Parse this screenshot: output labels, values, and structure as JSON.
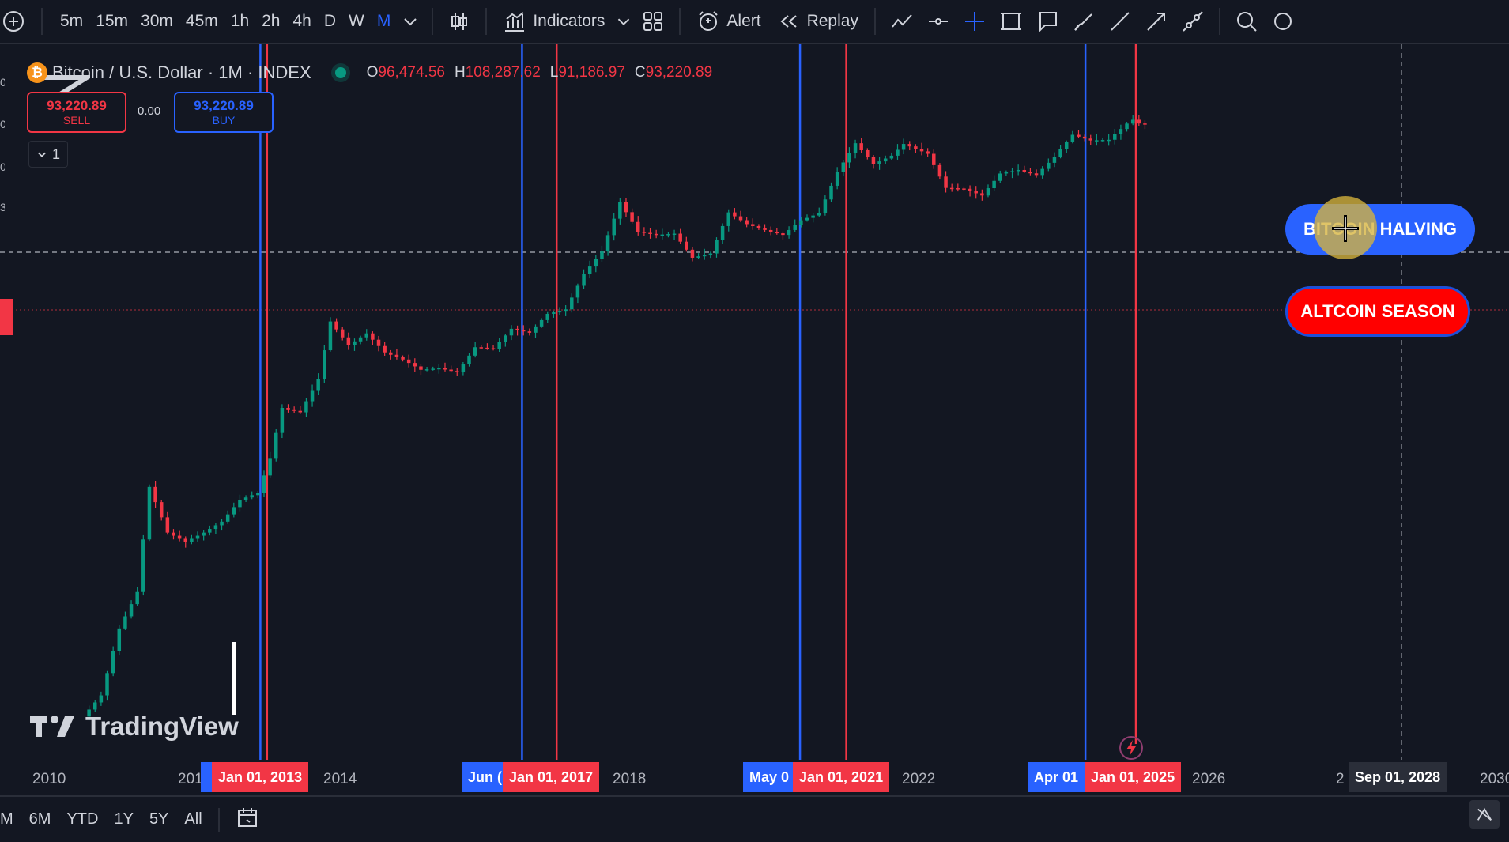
{
  "toolbar": {
    "intervals": [
      "5m",
      "15m",
      "30m",
      "45m",
      "1h",
      "2h",
      "4h",
      "D",
      "W",
      "M"
    ],
    "active_interval": "M",
    "indicators_label": "Indicators",
    "alert_label": "Alert",
    "replay_label": "Replay"
  },
  "legend": {
    "logo_letter": "₿",
    "symbol_title": "Bitcoin / U.S. Dollar · 1M · INDEX",
    "open_key": "O",
    "open_val": "96,474.56",
    "high_key": "H",
    "high_val": "108,287.62",
    "low_key": "L",
    "low_val": "91,186.97",
    "close_key": "C",
    "close_val": "93,220.89"
  },
  "trade": {
    "sell_price": "93,220.89",
    "sell_label": "SELL",
    "spread": "0.00",
    "buy_price": "93,220.89",
    "buy_label": "BUY",
    "collapse_count": "1"
  },
  "annotations": {
    "halving": "BITCOIN HALVING",
    "altcoin": "ALTCOIN SEASON"
  },
  "watermark": "TradingView",
  "time_axis": {
    "years": [
      "2010",
      "201",
      "2014",
      "2018",
      "2022",
      "2026",
      "2",
      "2030"
    ],
    "halving_tags": [
      "",
      "Jun (",
      "May 0",
      "Apr 01"
    ],
    "season_tags": [
      "Jan 01, 2013",
      "Jan 01, 2017",
      "Jan 01, 2021",
      "Jan 01, 2025"
    ],
    "cursor_tag": "Sep 01, 2028"
  },
  "bottom_bar": {
    "ranges": [
      "M",
      "6M",
      "YTD",
      "1Y",
      "5Y",
      "All"
    ]
  },
  "colors": {
    "background": "#131722",
    "up_candle": "#089981",
    "down_candle": "#f23645",
    "halving_line": "#2962ff",
    "season_line": "#f23645"
  },
  "chart_data": {
    "type": "candlestick",
    "symbol": "Bitcoin / U.S. Dollar",
    "interval": "1M",
    "scale": "log",
    "x_range": [
      "2010-01",
      "2030-01"
    ],
    "price_series": [
      [
        "2010-07",
        0.06
      ],
      [
        "2010-10",
        0.1
      ],
      [
        "2011-01",
        0.5
      ],
      [
        "2011-04",
        1.2
      ],
      [
        "2011-06",
        15
      ],
      [
        "2011-09",
        5
      ],
      [
        "2011-12",
        4
      ],
      [
        "2012-03",
        5
      ],
      [
        "2012-06",
        6.5
      ],
      [
        "2012-09",
        11
      ],
      [
        "2012-12",
        13
      ],
      [
        "2013-02",
        30
      ],
      [
        "2013-04",
        100
      ],
      [
        "2013-07",
        90
      ],
      [
        "2013-10",
        200
      ],
      [
        "2013-12",
        800
      ],
      [
        "2014-03",
        450
      ],
      [
        "2014-06",
        600
      ],
      [
        "2014-09",
        380
      ],
      [
        "2014-12",
        320
      ],
      [
        "2015-03",
        250
      ],
      [
        "2015-06",
        260
      ],
      [
        "2015-09",
        235
      ],
      [
        "2015-12",
        430
      ],
      [
        "2016-03",
        415
      ],
      [
        "2016-06",
        670
      ],
      [
        "2016-09",
        610
      ],
      [
        "2016-12",
        960
      ],
      [
        "2017-03",
        1070
      ],
      [
        "2017-06",
        2500
      ],
      [
        "2017-09",
        4300
      ],
      [
        "2017-12",
        14000
      ],
      [
        "2018-03",
        6900
      ],
      [
        "2018-06",
        6400
      ],
      [
        "2018-09",
        6600
      ],
      [
        "2018-12",
        3700
      ],
      [
        "2019-03",
        4100
      ],
      [
        "2019-06",
        11000
      ],
      [
        "2019-09",
        8300
      ],
      [
        "2019-12",
        7200
      ],
      [
        "2020-03",
        6400
      ],
      [
        "2020-06",
        9100
      ],
      [
        "2020-09",
        10800
      ],
      [
        "2020-12",
        29000
      ],
      [
        "2021-03",
        58000
      ],
      [
        "2021-06",
        35000
      ],
      [
        "2021-09",
        43000
      ],
      [
        "2021-11",
        57000
      ],
      [
        "2022-03",
        45000
      ],
      [
        "2022-06",
        19800
      ],
      [
        "2022-09",
        19400
      ],
      [
        "2022-12",
        16500
      ],
      [
        "2023-03",
        28000
      ],
      [
        "2023-06",
        30500
      ],
      [
        "2023-09",
        27000
      ],
      [
        "2023-12",
        42000
      ],
      [
        "2024-03",
        71000
      ],
      [
        "2024-06",
        62000
      ],
      [
        "2024-09",
        63000
      ],
      [
        "2024-12",
        93000
      ],
      [
        "2025-01",
        102000
      ],
      [
        "2025-02",
        93220.89
      ]
    ],
    "halving_lines": [
      "Nov 28, 2012",
      "Jul 09, 2016",
      "May 11, 2020",
      "Apr 20, 2024"
    ],
    "altcoin_season_lines": [
      "Jan 01, 2013",
      "Jan 01, 2017",
      "Jan 01, 2021",
      "Jan 01, 2025"
    ],
    "crosshair_date": "Sep 01, 2028",
    "grid": false
  }
}
